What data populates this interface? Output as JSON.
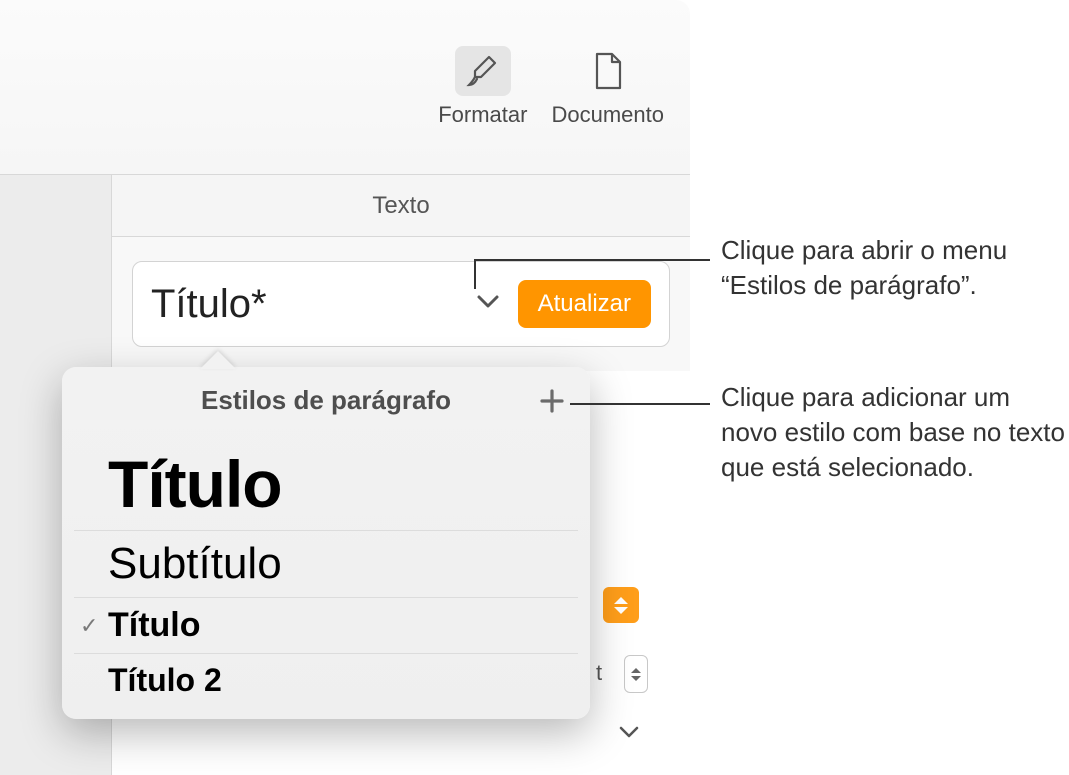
{
  "toolbar": {
    "format_label": "Formatar",
    "document_label": "Documento"
  },
  "panel": {
    "tab_label": "Texto",
    "current_style": "Título*",
    "update_label": "Atualizar",
    "pt_suffix": "t"
  },
  "popover": {
    "title": "Estilos de parágrafo",
    "styles": [
      {
        "label": "Título",
        "selected": false,
        "variant": "titulo"
      },
      {
        "label": "Subtítulo",
        "selected": false,
        "variant": "subtitulo"
      },
      {
        "label": "Título",
        "selected": true,
        "variant": "titulo-sel"
      },
      {
        "label": "Título 2",
        "selected": false,
        "variant": "titulo2"
      }
    ]
  },
  "callouts": {
    "open_menu": "Clique para abrir o menu “Estilos de parágrafo”.",
    "add_style": "Clique para adicionar um novo estilo com base no texto que está selecionado."
  },
  "colors": {
    "accent": "#ff9500"
  }
}
